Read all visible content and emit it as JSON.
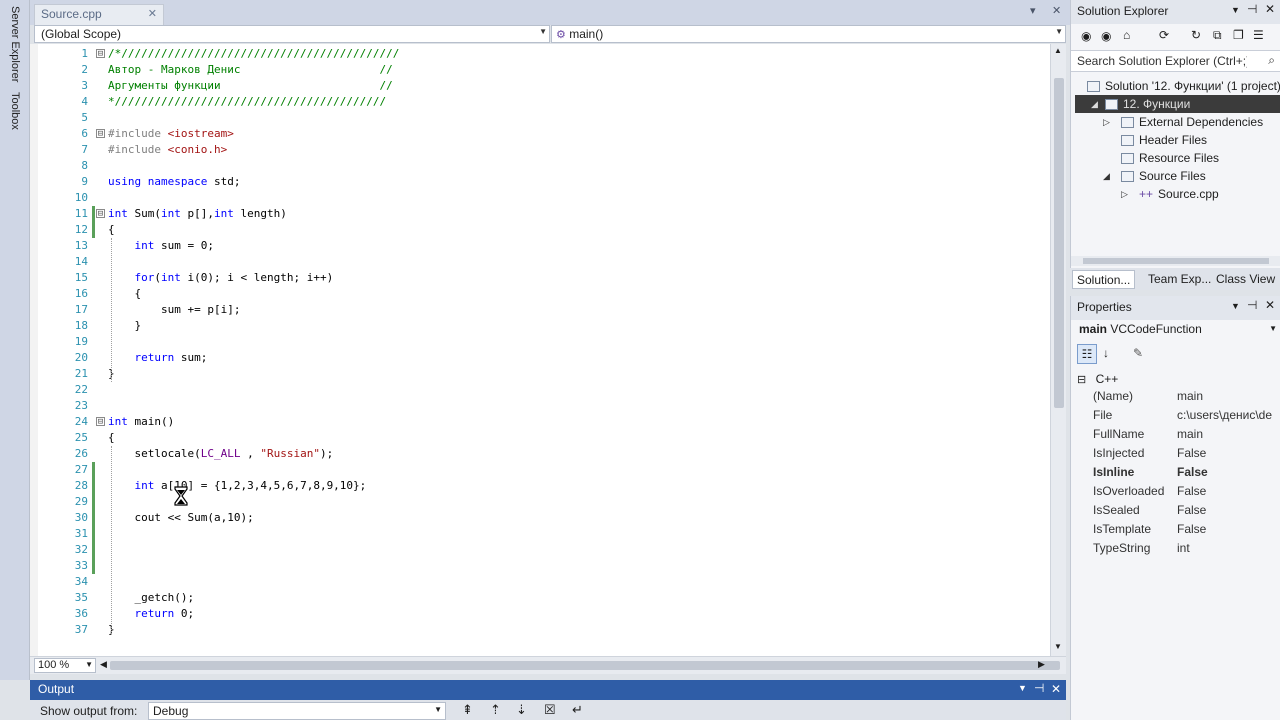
{
  "left_strip": {
    "server_explorer": "Server Explorer",
    "toolbox": "Toolbox"
  },
  "doc_tab": {
    "title": "Source.cpp",
    "close": "✕"
  },
  "nav": {
    "scope": "(Global Scope)",
    "member": "main()"
  },
  "editor": {
    "zoom": "100 %",
    "lines": [
      {
        "n": "1",
        "segs": [
          [
            "cm",
            "/*//////////////////////////////////////////"
          ]
        ],
        "ol": "⊟"
      },
      {
        "n": "2",
        "segs": [
          [
            "cm",
            "Автор - Марков Денис                     //"
          ]
        ]
      },
      {
        "n": "3",
        "segs": [
          [
            "cm",
            "Аргументы функции                        //"
          ]
        ]
      },
      {
        "n": "4",
        "segs": [
          [
            "cm",
            "*/////////////////////////////////////////"
          ]
        ]
      },
      {
        "n": "5",
        "segs": []
      },
      {
        "n": "6",
        "segs": [
          [
            "pp",
            "#include "
          ],
          [
            "str",
            "<iostream>"
          ]
        ],
        "ol": "⊟"
      },
      {
        "n": "7",
        "segs": [
          [
            "pp",
            "#include "
          ],
          [
            "str",
            "<conio.h>"
          ]
        ]
      },
      {
        "n": "8",
        "segs": []
      },
      {
        "n": "9",
        "segs": [
          [
            "kw",
            "using namespace "
          ],
          [
            "",
            "std;"
          ]
        ]
      },
      {
        "n": "10",
        "segs": []
      },
      {
        "n": "11",
        "segs": [
          [
            "kw",
            "int "
          ],
          [
            "",
            "Sum("
          ],
          [
            "kw",
            "int "
          ],
          [
            "",
            "p[],"
          ],
          [
            "kw",
            "int "
          ],
          [
            "",
            "length)"
          ]
        ],
        "ol": "⊟",
        "chg": true
      },
      {
        "n": "12",
        "segs": [
          [
            "",
            "{"
          ]
        ]
      },
      {
        "n": "13",
        "segs": [
          [
            "",
            "    "
          ],
          [
            "kw",
            "int "
          ],
          [
            "",
            "sum = 0;"
          ]
        ]
      },
      {
        "n": "14",
        "segs": []
      },
      {
        "n": "15",
        "segs": [
          [
            "",
            "    "
          ],
          [
            "kw",
            "for"
          ],
          [
            "",
            "("
          ],
          [
            "kw",
            "int "
          ],
          [
            "",
            "i(0); i < length; i++)"
          ]
        ]
      },
      {
        "n": "16",
        "segs": [
          [
            "",
            "    {"
          ]
        ]
      },
      {
        "n": "17",
        "segs": [
          [
            "",
            "        sum += p[i];"
          ]
        ]
      },
      {
        "n": "18",
        "segs": [
          [
            "",
            "    }"
          ]
        ]
      },
      {
        "n": "19",
        "segs": []
      },
      {
        "n": "20",
        "segs": [
          [
            "",
            "    "
          ],
          [
            "kw",
            "return "
          ],
          [
            "",
            "sum;"
          ]
        ]
      },
      {
        "n": "21",
        "segs": [
          [
            "",
            "}"
          ]
        ]
      },
      {
        "n": "22",
        "segs": []
      },
      {
        "n": "23",
        "segs": []
      },
      {
        "n": "24",
        "segs": [
          [
            "kw",
            "int "
          ],
          [
            "",
            "main()"
          ]
        ],
        "ol": "⊟"
      },
      {
        "n": "25",
        "segs": [
          [
            "",
            "{"
          ]
        ]
      },
      {
        "n": "26",
        "segs": [
          [
            "",
            "    setlocale("
          ],
          [
            "mac",
            "LC_ALL"
          ],
          [
            "",
            " , "
          ],
          [
            "str",
            "\"Russian\""
          ],
          [
            "",
            ");"
          ]
        ]
      },
      {
        "n": "27",
        "segs": []
      },
      {
        "n": "28",
        "segs": [
          [
            "",
            "    "
          ],
          [
            "kw",
            "int "
          ],
          [
            "",
            "a[10] = {1,2,3,4,5,6,7,8,9,10};"
          ]
        ]
      },
      {
        "n": "29",
        "segs": []
      },
      {
        "n": "30",
        "segs": [
          [
            "",
            "    cout << Sum(a,10);"
          ]
        ]
      },
      {
        "n": "31",
        "segs": []
      },
      {
        "n": "32",
        "segs": []
      },
      {
        "n": "33",
        "segs": []
      },
      {
        "n": "34",
        "segs": []
      },
      {
        "n": "35",
        "segs": [
          [
            "",
            "    _getch();"
          ]
        ]
      },
      {
        "n": "36",
        "segs": [
          [
            "",
            "    "
          ],
          [
            "kw",
            "return "
          ],
          [
            "",
            "0;"
          ]
        ]
      },
      {
        "n": "37",
        "segs": [
          [
            "",
            "}"
          ]
        ]
      }
    ]
  },
  "output": {
    "title": "Output",
    "show_from_label": "Show output from:",
    "source": "Debug"
  },
  "solution_explorer": {
    "title": "Solution Explorer",
    "search_placeholder": "Search Solution Explorer (Ctrl+;)",
    "items": [
      {
        "label": "Solution '12. Функции' (1 project)"
      },
      {
        "label": "12. Функции"
      },
      {
        "label": "External Dependencies"
      },
      {
        "label": "Header Files"
      },
      {
        "label": "Resource Files"
      },
      {
        "label": "Source Files"
      },
      {
        "label": "Source.cpp"
      }
    ],
    "tabs": [
      "Solution...",
      "Team Exp...",
      "Class View"
    ]
  },
  "properties": {
    "title": "Properties",
    "object": "main",
    "object_type": "VCCodeFunction",
    "category": "C++",
    "rows": [
      {
        "name": "(Name)",
        "value": "main"
      },
      {
        "name": "File",
        "value": "c:\\users\\денис\\de"
      },
      {
        "name": "FullName",
        "value": "main"
      },
      {
        "name": "IsInjected",
        "value": "False"
      },
      {
        "name": "IsInline",
        "value": "False"
      },
      {
        "name": "IsOverloaded",
        "value": "False"
      },
      {
        "name": "IsSealed",
        "value": "False"
      },
      {
        "name": "IsTemplate",
        "value": "False"
      },
      {
        "name": "TypeString",
        "value": "int"
      }
    ]
  }
}
